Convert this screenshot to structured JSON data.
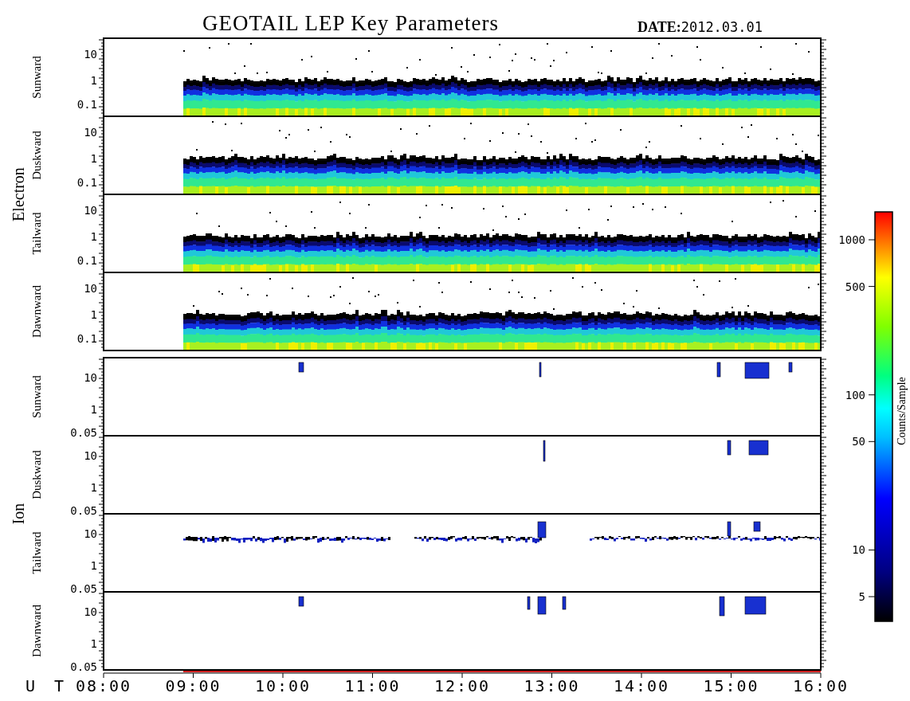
{
  "title": "GEOTAIL LEP Key Parameters",
  "date_label": "DATE:",
  "date": "2012.03.01",
  "groups": [
    {
      "species": "Electron",
      "kind": "electron",
      "panels": [
        {
          "direction": "Sunward",
          "yticks": [
            "10",
            "1",
            "0.1"
          ]
        },
        {
          "direction": "Duskward",
          "yticks": [
            "10",
            "1",
            "0.1"
          ]
        },
        {
          "direction": "Tailward",
          "yticks": [
            "10",
            "1",
            "0.1"
          ]
        },
        {
          "direction": "Dawnward",
          "yticks": [
            "10",
            "1",
            "0.1"
          ]
        }
      ]
    },
    {
      "species": "Ion",
      "kind": "ion",
      "panels": [
        {
          "direction": "Sunward",
          "yticks": [
            "10",
            "1",
            "0.05"
          ]
        },
        {
          "direction": "Duskward",
          "yticks": [
            "10",
            "1",
            "0.05"
          ]
        },
        {
          "direction": "Tailward",
          "yticks": [
            "10",
            "1",
            "0.05"
          ]
        },
        {
          "direction": "Dawnward",
          "yticks": [
            "10",
            "1",
            "0.05"
          ]
        }
      ]
    }
  ],
  "x_axis": {
    "label": "U T",
    "ticks": [
      "08:00",
      "09:00",
      "10:00",
      "11:00",
      "12:00",
      "13:00",
      "14:00",
      "15:00",
      "16:00"
    ]
  },
  "colorbar": {
    "label": "Counts/Sample",
    "ticks": [
      "1000",
      "500",
      "100",
      "50",
      "10",
      "5"
    ]
  }
}
